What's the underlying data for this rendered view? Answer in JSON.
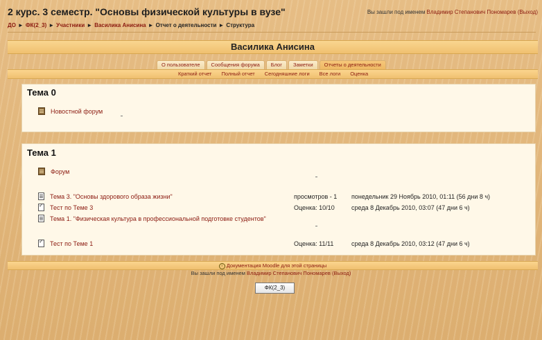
{
  "header": {
    "course_title": "2 курс. 3 семестр. \"Основы физической культуры в вузе\"",
    "login_prefix": "Вы зашли под именем",
    "user_name": "Владимир Степанович Пономарев",
    "logout": "(Выход)"
  },
  "breadcrumb": {
    "items": [
      "ДО",
      "ФК(2_3)",
      "Участники",
      "Василика Анисина",
      "Отчет о деятельности",
      "Структура"
    ]
  },
  "user_heading": "Василика Анисина",
  "tabs": [
    "О пользователе",
    "Сообщения форума",
    "Блог",
    "Заметки",
    "Отчеты о деятельности"
  ],
  "subtabs": [
    "Краткий отчет",
    "Полный отчет",
    "Сегодняшние логи",
    "Все логи",
    "Оценка"
  ],
  "sections": [
    {
      "title": "Тема 0",
      "items": [
        {
          "icon": "forum-icon",
          "label": "Новостной форум",
          "info": "",
          "date": ""
        }
      ]
    },
    {
      "title": "Тема 1",
      "items": [
        {
          "icon": "forum-icon",
          "label": "Форум",
          "info": "",
          "date": ""
        },
        {
          "icon": "resource-icon",
          "label": "Тема 3. \"Основы здорового образа жизни\"",
          "info": "просмотров - 1",
          "date": "понедельник 29 Ноябрь 2010, 01:11 (56 дни 8 ч)"
        },
        {
          "icon": "quiz-icon",
          "label": "Тест по Теме 3",
          "info": "Оценка: 10/10",
          "date": "среда 8 Декабрь 2010, 03:07 (47 дни 6 ч)"
        },
        {
          "icon": "resource-icon",
          "label": "Тема 1. \"Физическая культура в профессиональной подготовке студентов\"",
          "info": "",
          "date": ""
        },
        {
          "icon": "quiz-icon",
          "label": "Тест по Теме 1",
          "info": "Оценка: 11/11",
          "date": "среда 8 Декабрь 2010, 03:12 (47 дни 6 ч)"
        }
      ]
    }
  ],
  "footer": {
    "doc_link": "Документация Moodle для этой страницы",
    "login_prefix": "Вы зашли под именем",
    "user_name": "Владимир Степанович Пономарев",
    "logout": "(Выход)",
    "course_button": "ФК(2_3)"
  },
  "colors": {
    "link": "#8b1a10",
    "bar": "#f0c070",
    "section_bg": "#fff8e8",
    "page_bg": "#e2b77d"
  }
}
